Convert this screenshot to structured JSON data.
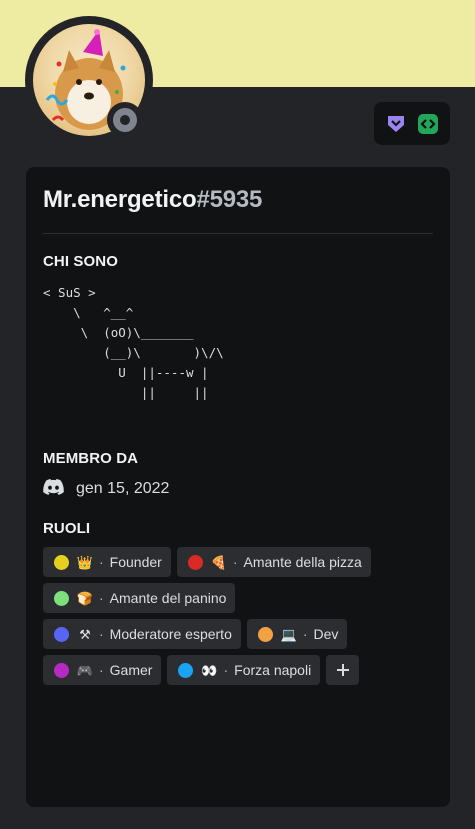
{
  "profile": {
    "username": "Mr.energetico",
    "discriminator": "#5935",
    "status": "offline",
    "banner_color": "#eeeba2"
  },
  "sections": {
    "about_title": "CHI SONO",
    "about_text": "< SuS >\n    \\   ^__^\n     \\  (oO)\\_______\n        (__)\\       )\\/\\\n          U  ||----w |\n             ||     ||",
    "member_title": "MEMBRO DA",
    "member_since": "gen 15, 2022",
    "roles_title": "RUOLI"
  },
  "roles": [
    {
      "color": "#e3d01f",
      "emoji": "👑",
      "name": "Founder"
    },
    {
      "color": "#d92a25",
      "emoji": "🍕",
      "name": "Amante della pizza"
    },
    {
      "color": "#7ee07a",
      "emoji": "🍞",
      "name": "Amante del panino"
    },
    {
      "color": "#5865f2",
      "emoji": "⚒",
      "name": "Moderatore esperto"
    },
    {
      "color": "#f3a241",
      "emoji": "💻",
      "name": "Dev"
    },
    {
      "color": "#b52bc2",
      "emoji": "🎮",
      "name": "Gamer"
    },
    {
      "color": "#1aa3f5",
      "emoji": "👀",
      "name": "Forza napoli"
    }
  ],
  "separator": "·",
  "add_role_icon": "plus-icon",
  "badges": [
    "hypesquad-icon",
    "active-developer-icon"
  ]
}
